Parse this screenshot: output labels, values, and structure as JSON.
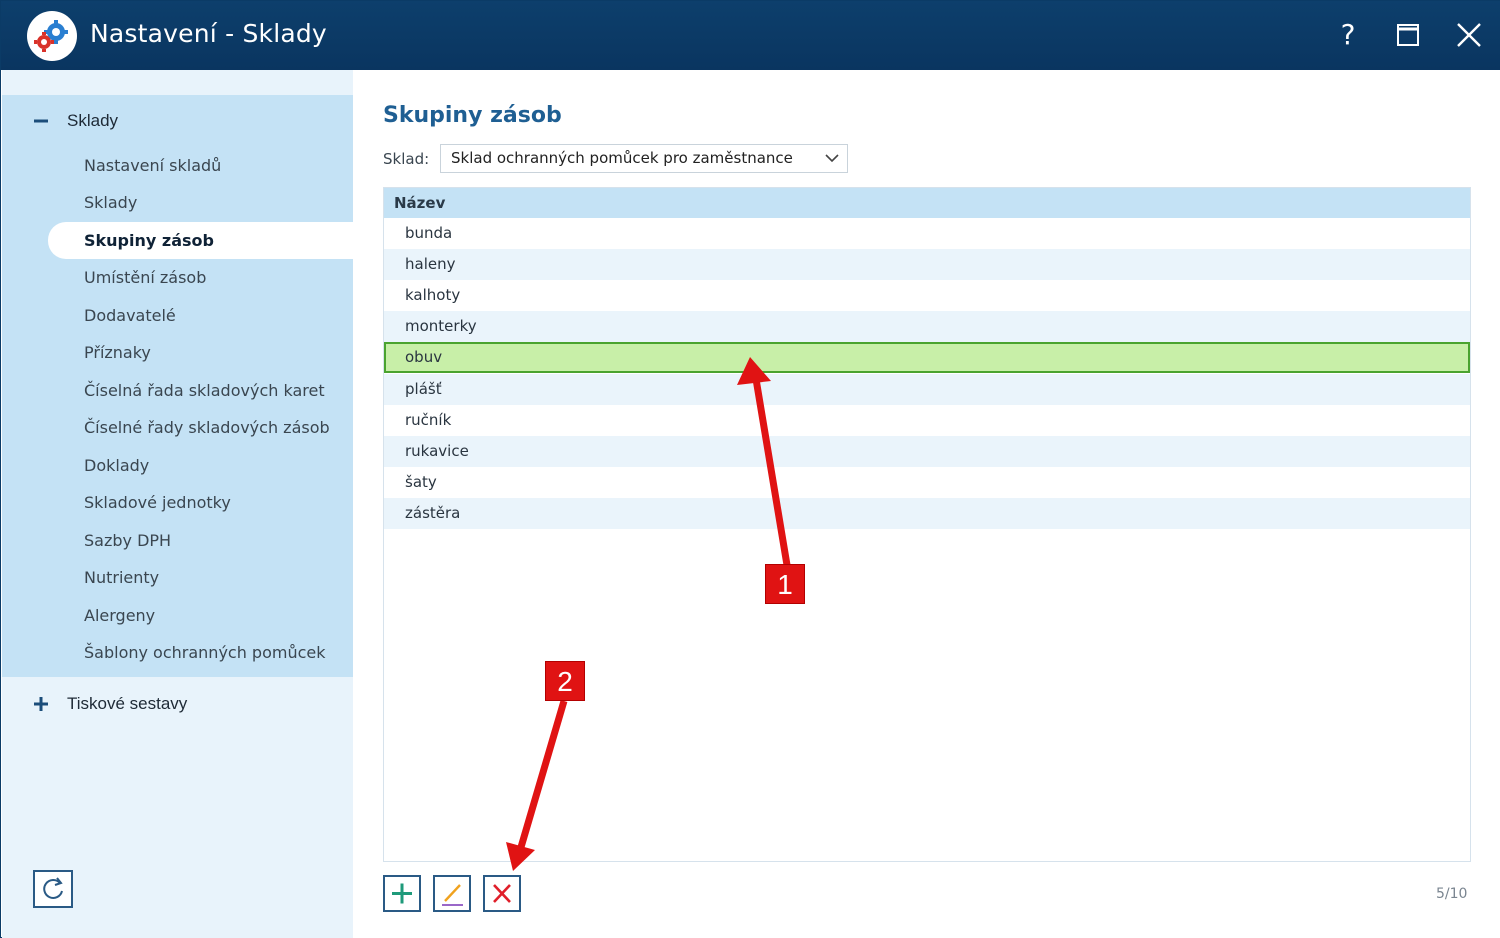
{
  "window": {
    "title": "Nastavení - Sklady",
    "help_label": "?"
  },
  "sidebar": {
    "group_expanded": {
      "label": "Sklady",
      "icon": "minus-icon"
    },
    "items": [
      {
        "label": "Nastavení skladů",
        "active": false
      },
      {
        "label": "Sklady",
        "active": false
      },
      {
        "label": "Skupiny zásob",
        "active": true
      },
      {
        "label": "Umístění zásob",
        "active": false
      },
      {
        "label": "Dodavatelé",
        "active": false
      },
      {
        "label": "Příznaky",
        "active": false
      },
      {
        "label": "Číselná řada skladových karet",
        "active": false
      },
      {
        "label": "Číselné řady skladových zásob",
        "active": false
      },
      {
        "label": "Doklady",
        "active": false
      },
      {
        "label": "Skladové jednotky",
        "active": false
      },
      {
        "label": "Sazby DPH",
        "active": false
      },
      {
        "label": "Nutrienty",
        "active": false
      },
      {
        "label": "Alergeny",
        "active": false
      },
      {
        "label": "Šablony ochranných pomůcek",
        "active": false
      }
    ],
    "group_collapsed": {
      "label": "Tiskové sestavy",
      "icon": "plus-icon"
    }
  },
  "main": {
    "heading": "Skupiny zásob",
    "sklad_label": "Sklad:",
    "sklad_value": "Sklad ochranných pomůcek pro zaměstnance",
    "table": {
      "column": "Název",
      "rows": [
        "bunda",
        "haleny",
        "kalhoty",
        "monterky",
        "obuv",
        "plášť",
        "ručník",
        "rukavice",
        "šaty",
        "zástěra"
      ],
      "selected_index": 4
    },
    "record_count": "5/10"
  },
  "annotations": {
    "badge_1": "1",
    "badge_2": "2",
    "arrow_color": "#e01313"
  },
  "colors": {
    "titlebar": "#0d3f6c",
    "heading": "#1f5f93",
    "selected_row": "#c8efa8",
    "selected_border": "#4aa32f",
    "sidebar_panel": "#c4e2f5"
  }
}
